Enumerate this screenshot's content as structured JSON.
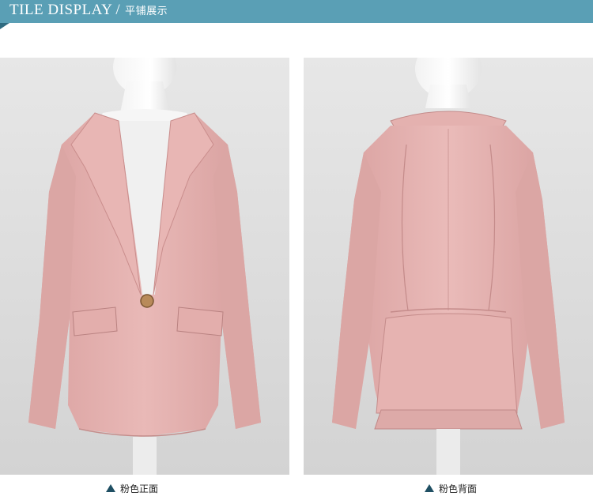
{
  "header": {
    "title": "TILE DISPLAY",
    "separator": "/",
    "subtitle": "平铺展示",
    "bar_color": "#5a9fb5"
  },
  "photos": {
    "front": {
      "description_icon": "triangle-up-icon",
      "caption": "粉色正面"
    },
    "back": {
      "description_icon": "triangle-up-icon",
      "caption": "粉色背面"
    },
    "jacket_color": "#e5b3b1"
  }
}
